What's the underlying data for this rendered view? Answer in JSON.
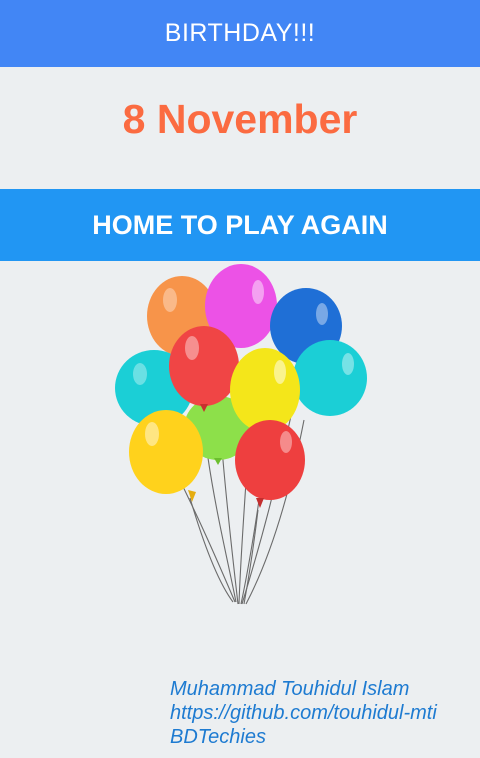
{
  "app_bar": {
    "title": "BIRTHDAY!!!"
  },
  "birthday": {
    "date": "8 November"
  },
  "actions": {
    "home_label": "HOME TO PLAY AGAIN"
  },
  "illustration": {
    "icon": "balloons-icon",
    "balloon_colors": [
      "#f7944a",
      "#ec52e6",
      "#1f6fd6",
      "#1bcfd6",
      "#f04545",
      "#f4e61a",
      "#8de04a",
      "#ffd21c",
      "#ee3f3f"
    ]
  },
  "credits": {
    "author": "Muhammad Touhidul Islam",
    "github": "https://github.com/touhidul-mti",
    "org": "BDTechies"
  },
  "colors": {
    "app_bar": "#4286f5",
    "date_text": "#fb6b41",
    "button": "#2196f3",
    "credits_text": "#1e7bd1",
    "background": "#eceff1"
  }
}
